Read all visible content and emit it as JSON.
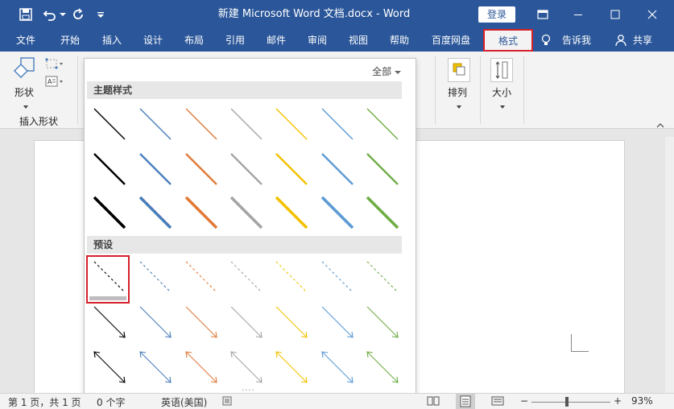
{
  "titlebar": {
    "doc_title": "新建 Microsoft Word 文档.docx - Word",
    "login_label": "登录",
    "save_icon": "save-icon",
    "undo_icon": "undo-icon",
    "redo_icon": "redo-icon",
    "customize_icon": "customize-quick-access-icon"
  },
  "menu": {
    "items": [
      "文件",
      "开始",
      "插入",
      "设计",
      "布局",
      "引用",
      "邮件",
      "审阅",
      "视图",
      "帮助",
      "百度网盘"
    ],
    "active_tab": "格式",
    "tell_me": "告诉我",
    "share": "共享"
  },
  "ribbon": {
    "shape_label": "形状",
    "insert_shapes_group": "插入形状",
    "arrange_label": "排列",
    "size_label": "大小"
  },
  "panel": {
    "filter_label": "全部",
    "theme_styles_title": "主题样式",
    "presets_title": "预设",
    "more_indicator": "····"
  },
  "statusbar": {
    "page_info": "第 1 页，共 1 页",
    "word_count": "0 个字",
    "language": "英语(美国)",
    "zoom_minus": "−",
    "zoom_plus": "+",
    "zoom_level": "93%"
  },
  "colors": {
    "titlebar": "#2b579a",
    "highlight": "#d6202a",
    "line_colors": [
      "#000000",
      "#4a7ebb",
      "#e07b39",
      "#a5a5a5",
      "#f2c200",
      "#5b9bd5",
      "#70ad47"
    ]
  }
}
